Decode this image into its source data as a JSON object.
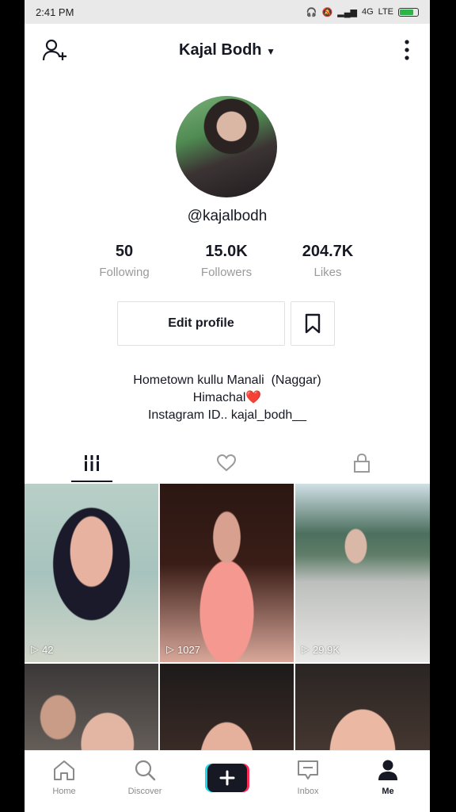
{
  "status_bar": {
    "time": "2:41 PM",
    "network": "4G",
    "lte": "LTE"
  },
  "header": {
    "title": "Kajal Bodh"
  },
  "profile": {
    "username": "@kajalbodh"
  },
  "stats": [
    {
      "value": "50",
      "label": "Following"
    },
    {
      "value": "15.0K",
      "label": "Followers"
    },
    {
      "value": "204.7K",
      "label": "Likes"
    }
  ],
  "actions": {
    "edit_profile_label": "Edit profile"
  },
  "bio": {
    "line1": "Hometown kullu Manali  (Naggar)",
    "line2": "Himachal",
    "line2_emoji": "❤️",
    "line3": "Instagram ID.. kajal_bodh__"
  },
  "tabs": [
    "videos-grid",
    "liked",
    "private"
  ],
  "videos": [
    {
      "views": "42"
    },
    {
      "views": "1027"
    },
    {
      "views": "29.9K"
    },
    {
      "views": ""
    },
    {
      "views": ""
    },
    {
      "views": ""
    }
  ],
  "bottom_nav": [
    {
      "label": "Home"
    },
    {
      "label": "Discover"
    },
    {
      "label": ""
    },
    {
      "label": "Inbox"
    },
    {
      "label": "Me"
    }
  ],
  "colors": {
    "text": "#161823",
    "muted": "#9a9a9a",
    "accent_cyan": "#20d5ec",
    "accent_red": "#fe2c55"
  }
}
